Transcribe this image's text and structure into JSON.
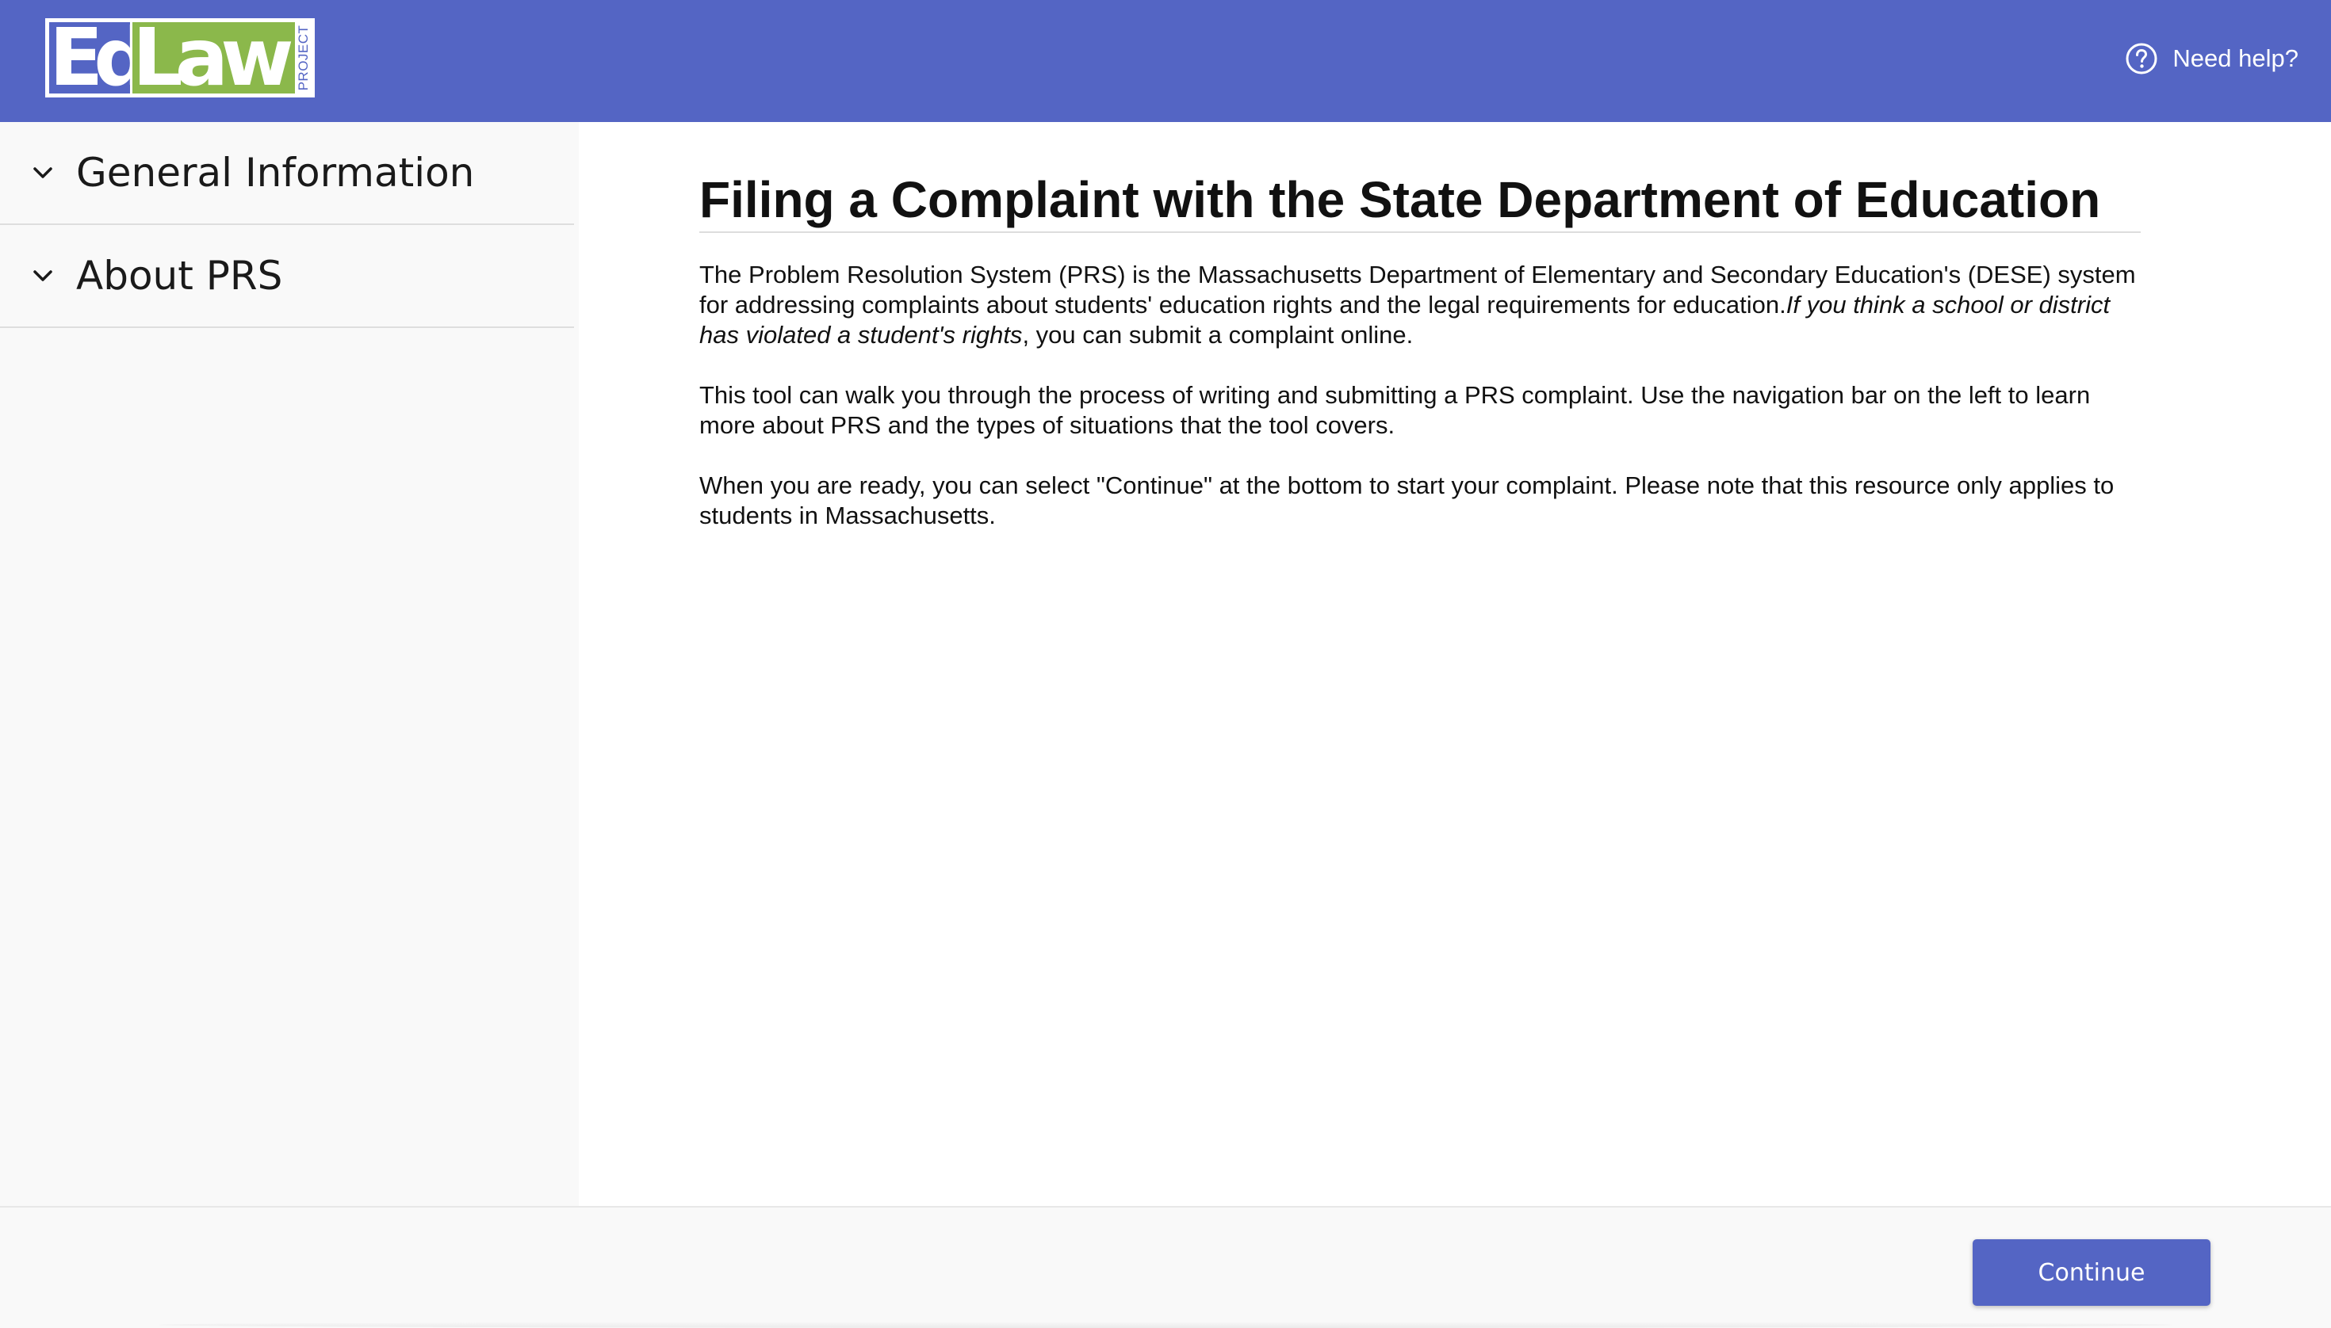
{
  "header": {
    "logo": {
      "ed": "Ed",
      "law": "Law",
      "project": "PROJECT"
    },
    "help_label": "Need help?",
    "help_icon": "question-circle-icon",
    "colors": {
      "header_bg": "#5465c4",
      "logo_green": "#8bb84b"
    }
  },
  "sidebar": {
    "items": [
      {
        "label": "General Information",
        "icon": "chevron-down-icon"
      },
      {
        "label": "About PRS",
        "icon": "chevron-down-icon"
      }
    ]
  },
  "main": {
    "title": "Filing a Complaint with the State Department of Education",
    "paragraphs": {
      "p1": {
        "text_a": "The Problem Resolution System (PRS) is the Massachusetts Department of Elementary and Secondary Education's (DESE) system for addressing complaints about students' education rights and the legal requirements for education.",
        "text_italic": "If you think a school or district has violated a student's rights",
        "text_b": ", you can submit a complaint online."
      },
      "p2": "This tool can walk you through the process of writing and submitting a PRS complaint. Use the navigation bar on the left to learn more about PRS and the types of situations that the tool covers.",
      "p3": "When you are ready, you can select \"Continue\" at the bottom to start your complaint. Please note that this resource only applies to students in Massachusetts."
    }
  },
  "footer": {
    "continue_label": "Continue",
    "button_color": "#5465c4"
  }
}
